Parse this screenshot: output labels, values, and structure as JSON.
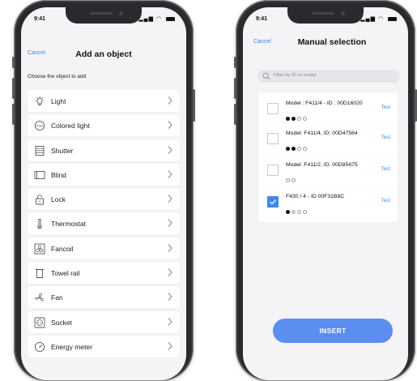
{
  "status_bar": {
    "time": "9:41",
    "signal_icon": "signal-icon",
    "wifi_icon": "wifi-icon",
    "battery_icon": "battery-icon"
  },
  "add_object_screen": {
    "cancel_label": "Cancel",
    "title": "Add an object",
    "subtitle": "Choose the object to add",
    "items": [
      {
        "label": "Light",
        "icon": "bulb-icon"
      },
      {
        "label": "Colored light",
        "icon": "rgb-icon"
      },
      {
        "label": "Shutter",
        "icon": "shutter-icon"
      },
      {
        "label": "Blind",
        "icon": "blind-icon"
      },
      {
        "label": "Lock",
        "icon": "lock-icon"
      },
      {
        "label": "Thermostat",
        "icon": "thermometer-icon"
      },
      {
        "label": "Fancoil",
        "icon": "fancoil-icon"
      },
      {
        "label": "Towel rail",
        "icon": "towel-rail-icon"
      },
      {
        "label": "Fan",
        "icon": "fan-icon"
      },
      {
        "label": "Socket",
        "icon": "socket-icon"
      },
      {
        "label": "Energy meter",
        "icon": "meter-icon"
      }
    ]
  },
  "manual_selection_screen": {
    "cancel_label": "Cancel",
    "title": "Manual selection",
    "search_placeholder": "Filter by ID or model",
    "devices": [
      {
        "name": "Model : F411/4 - ID : 00D16020",
        "dots": [
          "filled",
          "filled",
          "empty",
          "empty"
        ],
        "checked": false,
        "test_label": "Test"
      },
      {
        "name": "Model: F411/4, ID: 00D47564",
        "dots": [
          "filled",
          "filled",
          "empty",
          "empty"
        ],
        "checked": false,
        "test_label": "Test"
      },
      {
        "name": "Model: F411/2, ID: 00D85675",
        "dots": [
          "empty",
          "empty"
        ],
        "checked": false,
        "test_label": "Test"
      },
      {
        "name": "F430 / 4 - ID 00F31B8C",
        "dots": [
          "filled",
          "grey",
          "empty",
          "empty"
        ],
        "checked": true,
        "test_label": "Test"
      }
    ],
    "insert_label": "INSERT"
  },
  "colors": {
    "accent": "#3d86f4",
    "button": "#5b8ef0",
    "screen_bg": "#f4f4f6"
  }
}
